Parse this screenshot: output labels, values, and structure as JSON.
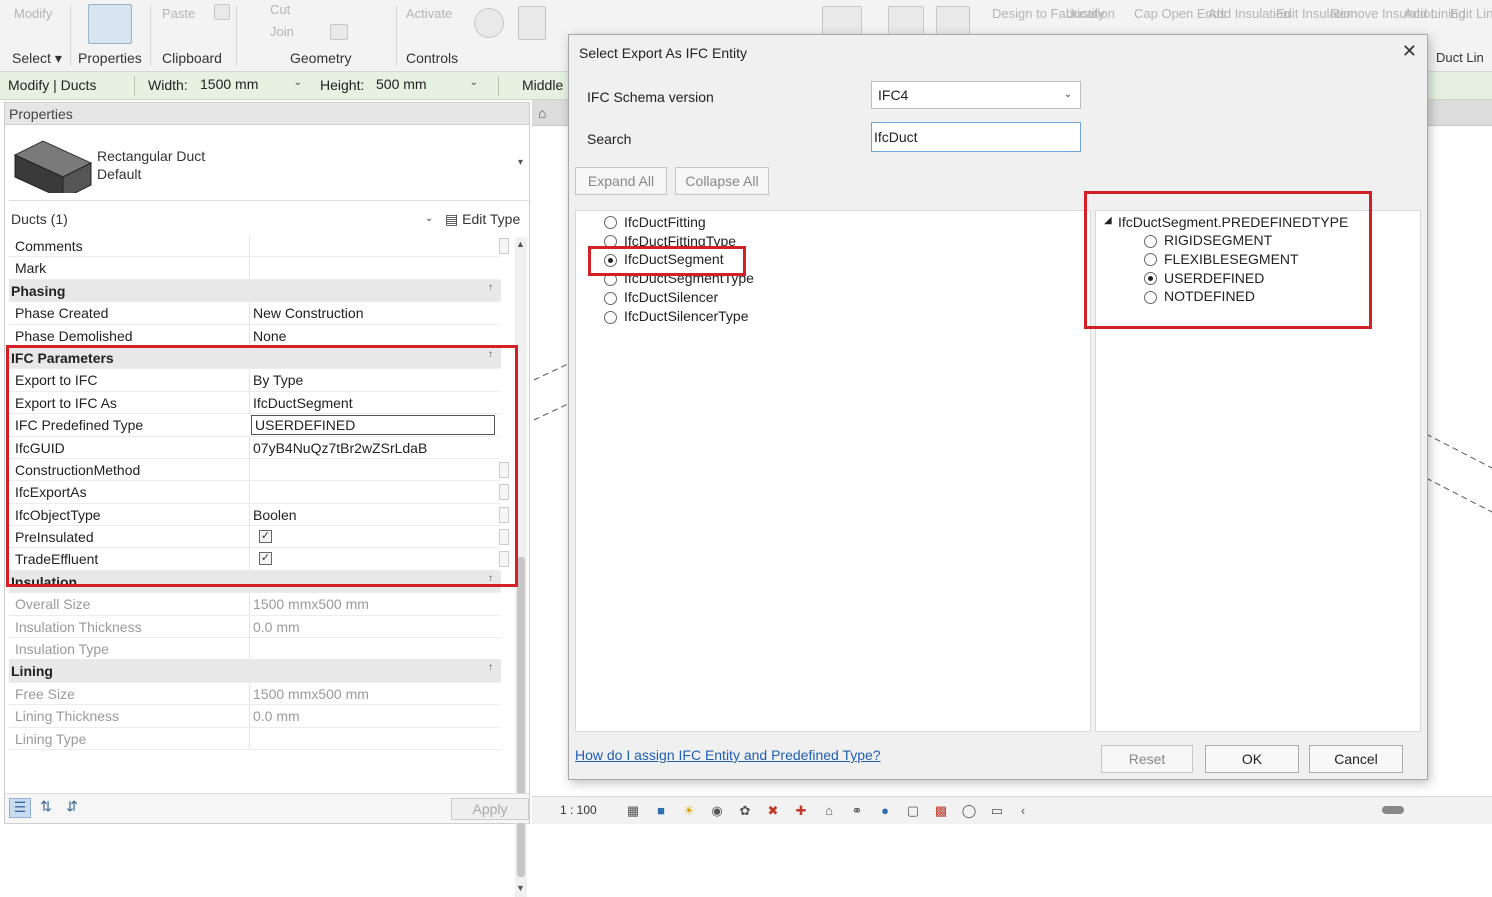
{
  "ribbon": {
    "ghost_items": [
      "Modify",
      "Paste",
      "Cut",
      "Join",
      "Activate",
      "Design to Fabrication",
      "Justify",
      "Cap Open Ends",
      "Add Insulation",
      "Edit Insulation",
      "Remove Insulation",
      "Add Lining",
      "Edit Lining",
      "Duct Lin"
    ],
    "select_label": "Select",
    "groups": [
      "Properties",
      "Clipboard",
      "Geometry",
      "Controls"
    ]
  },
  "options_bar": {
    "context": "Modify | Ducts",
    "width_label": "Width:",
    "width_value": "1500 mm",
    "height_label": "Height:",
    "height_value": "500 mm",
    "middle_label": "Middle"
  },
  "properties": {
    "title": "Properties",
    "type_name": "Rectangular Duct",
    "type_sub": "Default",
    "instance_count": "Ducts (1)",
    "edit_type": "Edit Type",
    "rows": [
      {
        "k": "Comments",
        "v": ""
      },
      {
        "k": "Mark",
        "v": ""
      }
    ],
    "phasing": {
      "header": "Phasing",
      "rows": [
        {
          "k": "Phase Created",
          "v": "New Construction"
        },
        {
          "k": "Phase Demolished",
          "v": "None"
        }
      ]
    },
    "ifc": {
      "header": "IFC Parameters",
      "export_to_ifc_k": "Export to IFC",
      "export_to_ifc_v": "By Type",
      "export_as_k": "Export to IFC As",
      "export_as_v": "IfcDuctSegment",
      "predef_k": "IFC Predefined Type",
      "predef_v": "USERDEFINED",
      "guid_k": "IfcGUID",
      "guid_v": "07yB4NuQz7tBr2wZSrLdaB",
      "constr_k": "ConstructionMethod",
      "exportas_k": "IfcExportAs",
      "objtype_k": "IfcObjectType",
      "objtype_v": "Boolen",
      "preins_k": "PreInsulated",
      "trade_k": "TradeEffluent"
    },
    "insulation": {
      "header": "Insulation",
      "rows": [
        {
          "k": "Overall Size",
          "v": "1500 mmx500 mm"
        },
        {
          "k": "Insulation Thickness",
          "v": "0.0 mm"
        },
        {
          "k": "Insulation Type",
          "v": ""
        }
      ]
    },
    "lining": {
      "header": "Lining",
      "rows": [
        {
          "k": "Free Size",
          "v": "1500 mmx500 mm"
        },
        {
          "k": "Lining Thickness",
          "v": "0.0 mm"
        },
        {
          "k": "Lining Type",
          "v": ""
        }
      ]
    },
    "apply": "Apply"
  },
  "status": {
    "scale": "1 : 100"
  },
  "dialog": {
    "title": "Select Export As IFC Entity",
    "schema_label": "IFC Schema version",
    "schema_value": "IFC4",
    "search_label": "Search",
    "search_value": "IfcDuct",
    "expand_all": "Expand All",
    "collapse_all": "Collapse All",
    "entities": [
      "IfcDuctFitting",
      "IfcDuctFittingType",
      "IfcDuctSegment",
      "IfcDuctSegmentType",
      "IfcDuctSilencer",
      "IfcDuctSilencerType"
    ],
    "selected_entity": "IfcDuctSegment",
    "predef_header": "IfcDuctSegment.PREDEFINEDTYPE",
    "predef_types": [
      "RIGIDSEGMENT",
      "FLEXIBLESEGMENT",
      "USERDEFINED",
      "NOTDEFINED"
    ],
    "selected_predef": "USERDEFINED",
    "help": "How do I assign IFC Entity and Predefined Type?",
    "reset": "Reset",
    "ok": "OK",
    "cancel": "Cancel"
  },
  "colors": {
    "annotation_red": "#d31f26",
    "options_bar_green": "#e6f1e2",
    "link_blue": "#1f5fb3"
  }
}
